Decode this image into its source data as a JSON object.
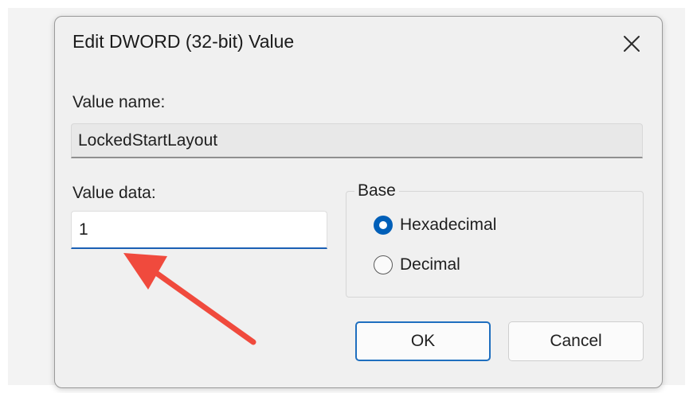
{
  "dialog": {
    "title": "Edit DWORD (32-bit) Value",
    "close_icon": "close-icon"
  },
  "value_name": {
    "label": "Value name:",
    "value": "LockedStartLayout"
  },
  "value_data": {
    "label": "Value data:",
    "value": "1"
  },
  "base": {
    "legend": "Base",
    "options": [
      {
        "label": "Hexadecimal",
        "selected": true
      },
      {
        "label": "Decimal",
        "selected": false
      }
    ]
  },
  "buttons": {
    "ok_label": "OK",
    "cancel_label": "Cancel"
  },
  "colors": {
    "accent": "#005fb8",
    "annotation_arrow": "#f04a3d"
  }
}
